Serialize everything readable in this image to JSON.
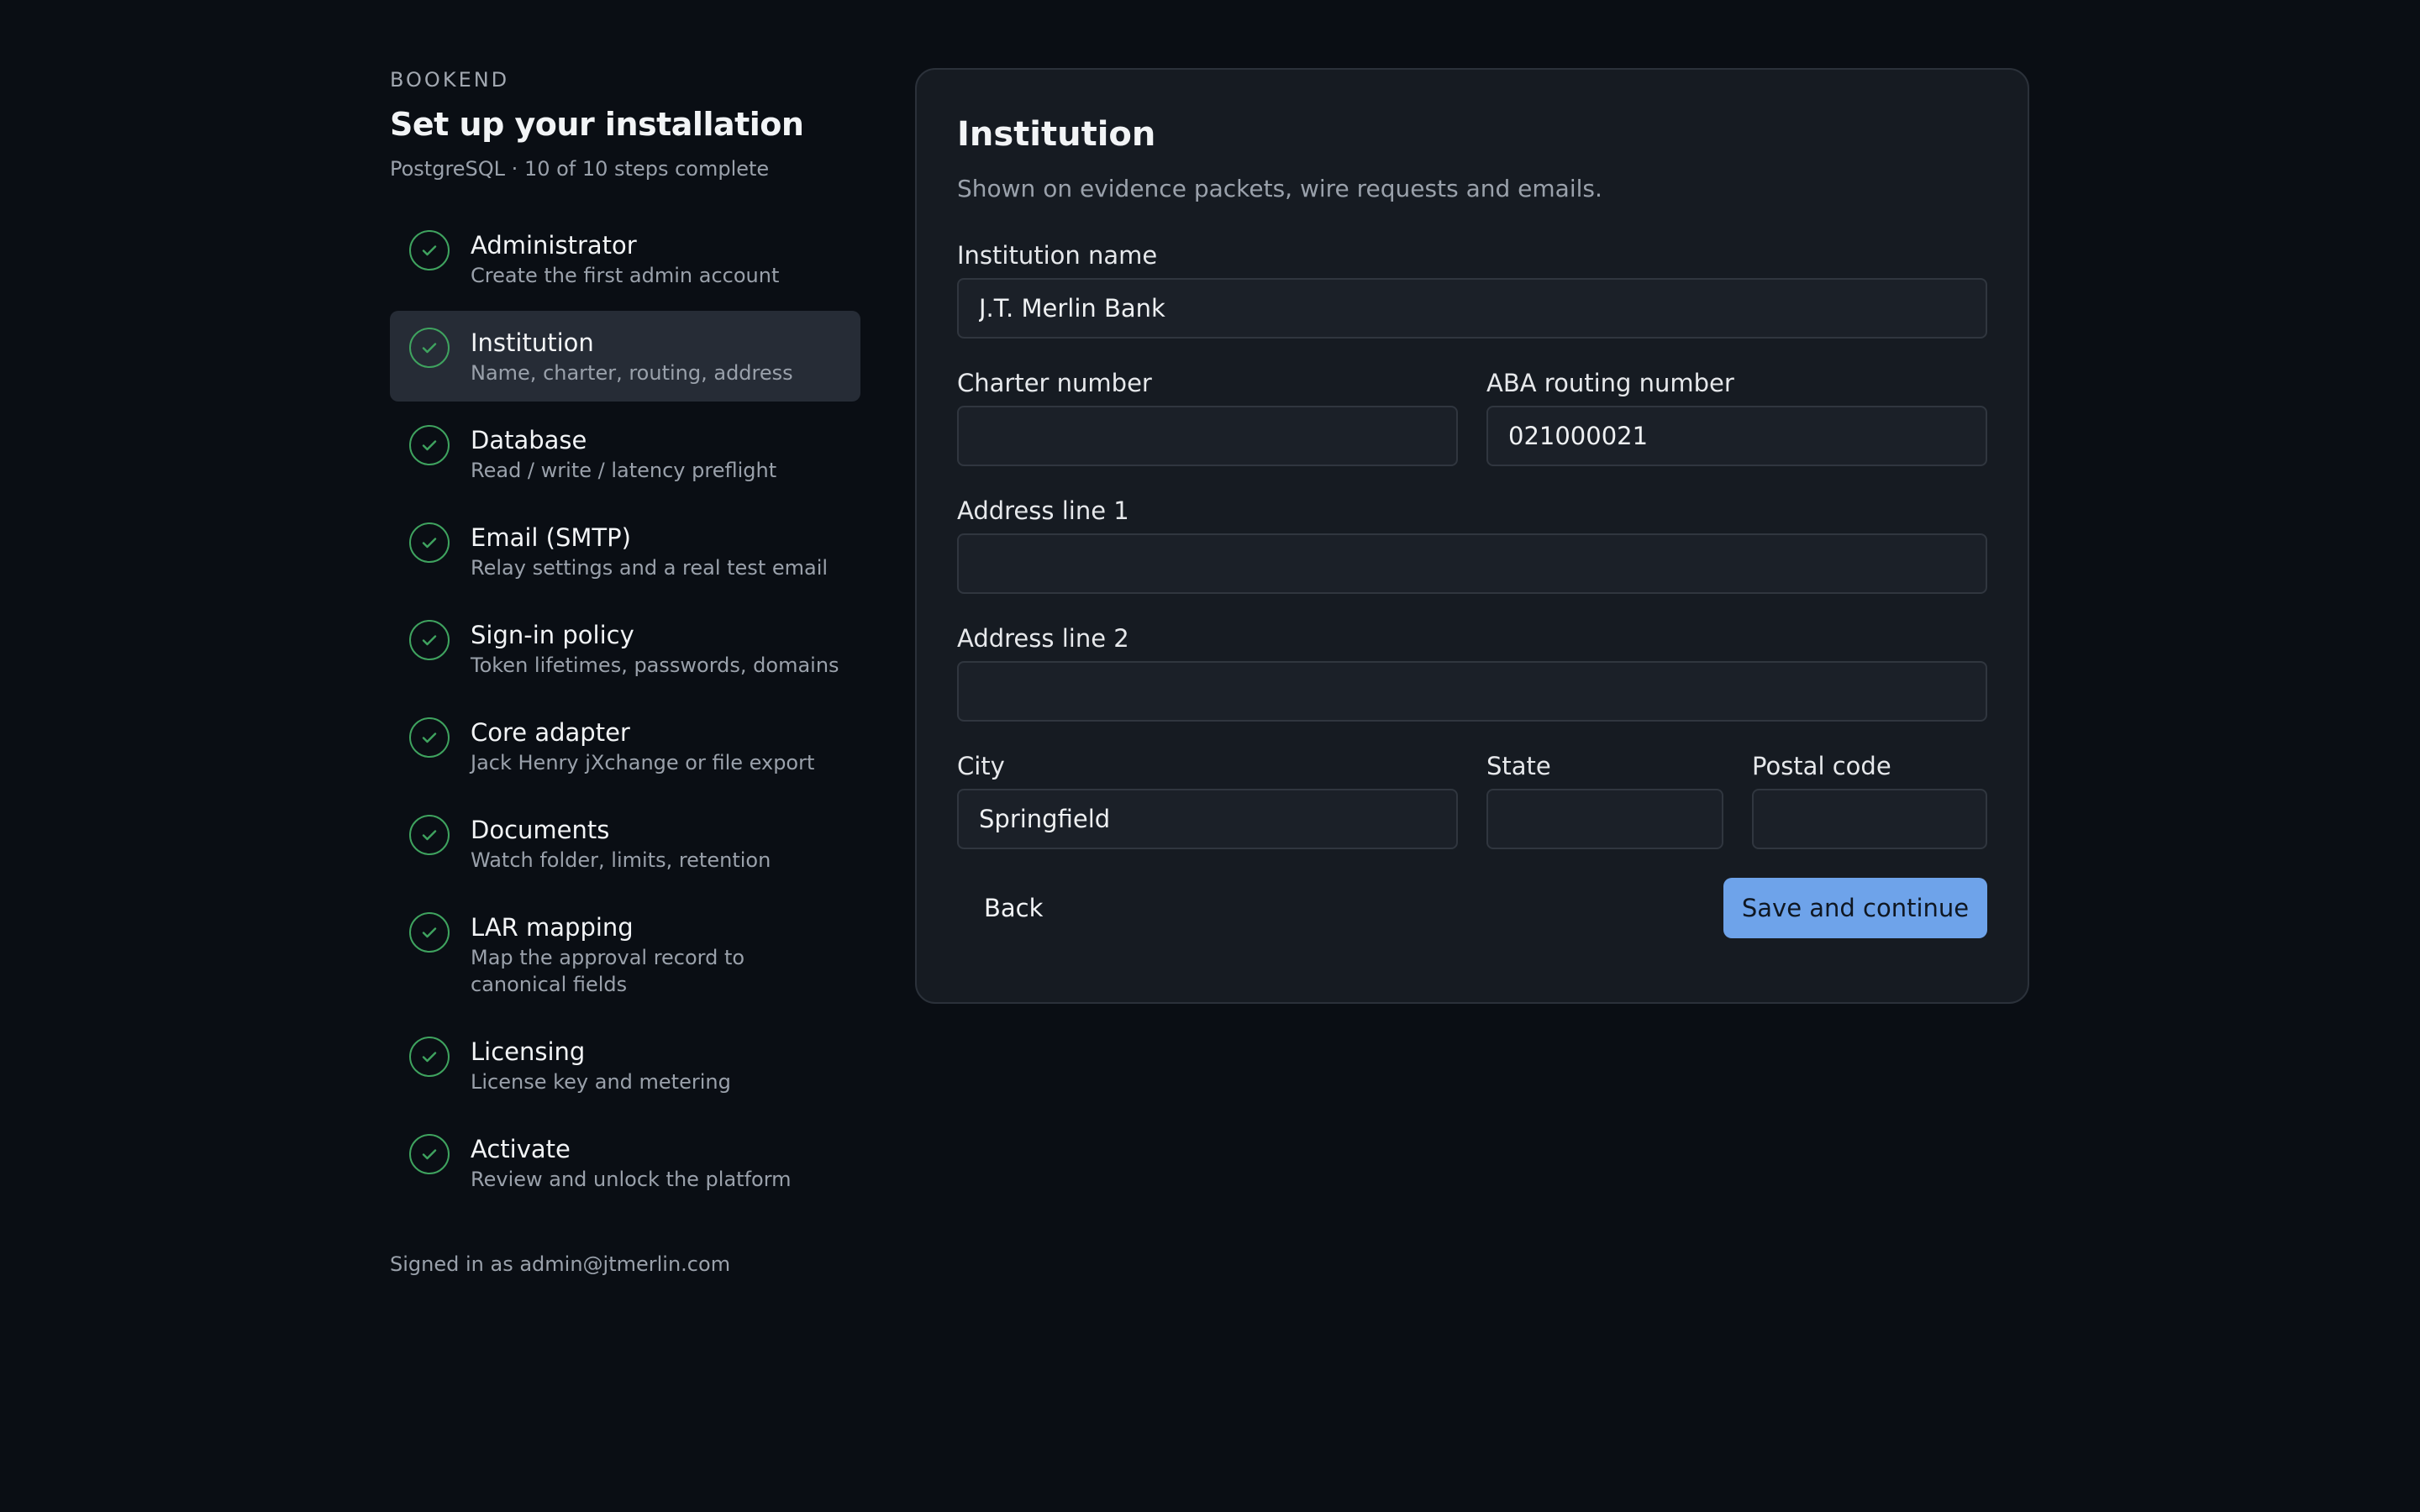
{
  "sidebar": {
    "brand": "BOOKEND",
    "title": "Set up your installation",
    "subtitle": "PostgreSQL · 10 of 10 steps complete",
    "active_index": 1,
    "steps": [
      {
        "label": "Administrator",
        "desc": "Create the first admin account",
        "icon": "check-circle-icon",
        "status": "complete"
      },
      {
        "label": "Institution",
        "desc": "Name, charter, routing, address",
        "icon": "check-circle-icon",
        "status": "complete"
      },
      {
        "label": "Database",
        "desc": "Read / write / latency preflight",
        "icon": "check-circle-icon",
        "status": "complete"
      },
      {
        "label": "Email (SMTP)",
        "desc": "Relay settings and a real test email",
        "icon": "check-circle-icon",
        "status": "complete"
      },
      {
        "label": "Sign-in policy",
        "desc": "Token lifetimes, passwords, domains",
        "icon": "check-circle-icon",
        "status": "complete"
      },
      {
        "label": "Core adapter",
        "desc": "Jack Henry jXchange or file export",
        "icon": "check-circle-icon",
        "status": "complete"
      },
      {
        "label": "Documents",
        "desc": "Watch folder, limits, retention",
        "icon": "check-circle-icon",
        "status": "complete"
      },
      {
        "label": "LAR mapping",
        "desc": "Map the approval record to canonical fields",
        "icon": "check-circle-icon",
        "status": "complete"
      },
      {
        "label": "Licensing",
        "desc": "License key and metering",
        "icon": "check-circle-icon",
        "status": "complete"
      },
      {
        "label": "Activate",
        "desc": "Review and unlock the platform",
        "icon": "check-circle-icon",
        "status": "complete"
      }
    ],
    "signed_in_prefix": "Signed in as",
    "signed_in_email": "admin@jtmerlin.com"
  },
  "form": {
    "title": "Institution",
    "subtitle": "Shown on evidence packets, wire requests and emails.",
    "fields": {
      "institution_name": {
        "label": "Institution name",
        "value": "J.T. Merlin Bank"
      },
      "charter_number": {
        "label": "Charter number",
        "value": ""
      },
      "aba_routing": {
        "label": "ABA routing number",
        "value": "021000021"
      },
      "address_line1": {
        "label": "Address line 1",
        "value": ""
      },
      "address_line2": {
        "label": "Address line 2",
        "value": ""
      },
      "city": {
        "label": "City",
        "value": "Springfield"
      },
      "state": {
        "label": "State",
        "value": ""
      },
      "postal_code": {
        "label": "Postal code",
        "value": ""
      }
    },
    "back_label": "Back",
    "save_label": "Save and continue"
  },
  "colors": {
    "background": "#0a0e14",
    "card": "#161b22",
    "active_step": "#262c36",
    "check": "#3fa35f",
    "primary": "#6ea3ea"
  }
}
